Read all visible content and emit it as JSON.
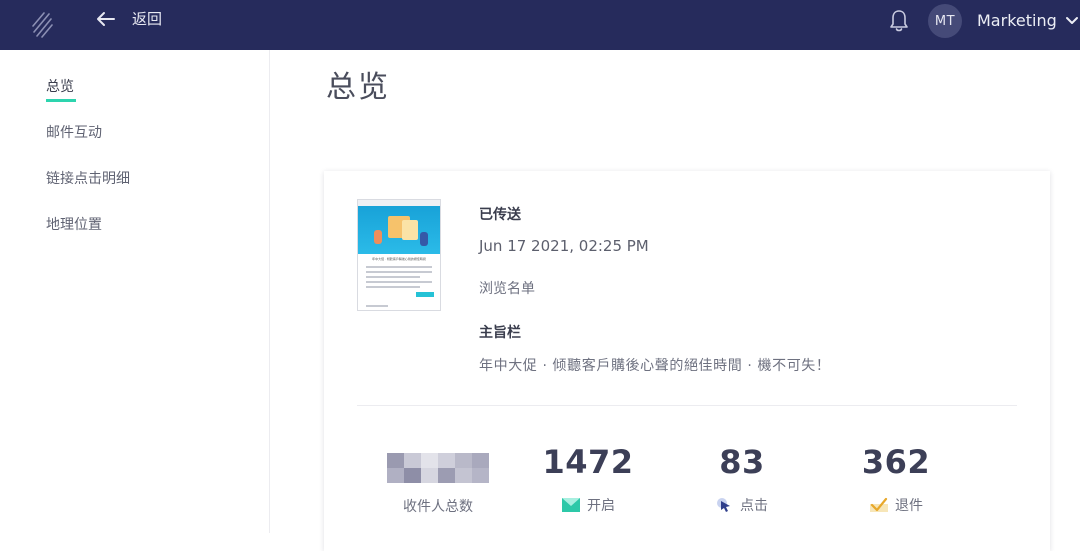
{
  "header": {
    "back_label": "返回",
    "avatar_initials": "MT",
    "account_name": "Marketing"
  },
  "sidebar": {
    "items": [
      {
        "label": "总览",
        "active": true
      },
      {
        "label": "邮件互动"
      },
      {
        "label": "链接点击明细"
      },
      {
        "label": "地理位置"
      }
    ]
  },
  "page": {
    "title": "总览"
  },
  "campaign": {
    "status_label": "已传送",
    "sent_at": "Jun 17 2021, 02:25 PM",
    "list_link": "浏览名单",
    "subject_label": "主旨栏",
    "subject": "年中大促 · 倾聽客戶購後心聲的絕佳時間 · 機不可失！",
    "thumbnail_headline": "年中大促 · 倾聽客戶購後心聲的絕佳時間"
  },
  "stats": {
    "recipients_label": "收件人总数",
    "opens": "1472",
    "opens_label": "开启",
    "clicks": "83",
    "clicks_label": "点击",
    "bounces": "362",
    "bounces_label": "退件"
  },
  "colors": {
    "topbar": "#262b5c",
    "accent": "#2dd4ae",
    "avatar": "#454a78"
  }
}
